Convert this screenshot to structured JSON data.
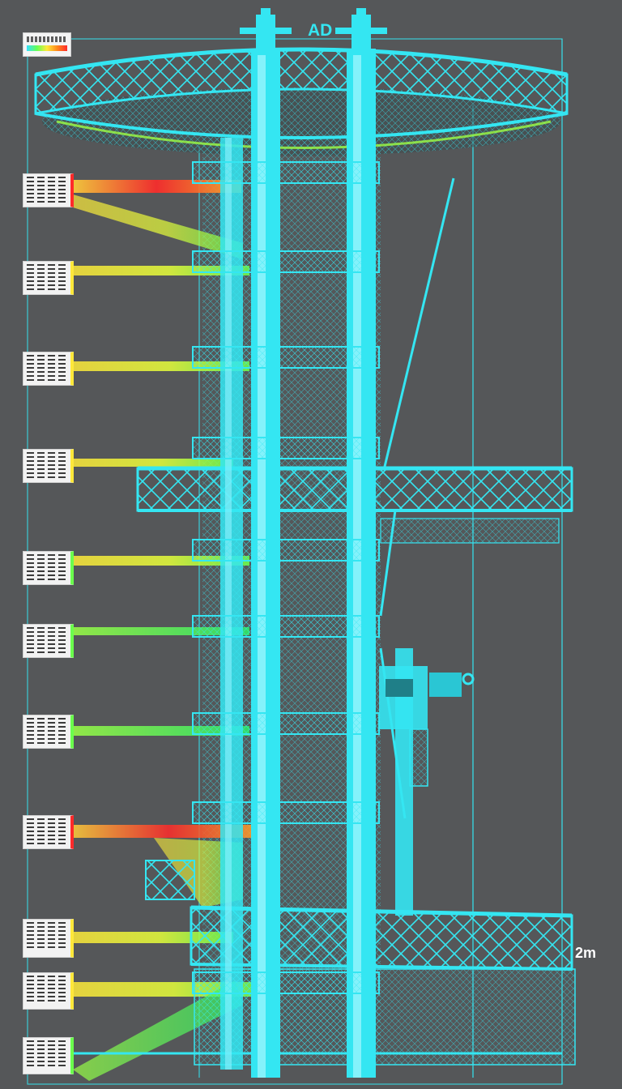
{
  "header": {
    "text": "AD"
  },
  "scale_bar": {
    "label": "2m"
  },
  "colors": {
    "background": "#555759",
    "structure": "#34e6f2",
    "structure_dark": "#1fb9c8",
    "heat_low": "#6bff4d",
    "heat_mid": "#ffe83a",
    "heat_high": "#ff2a2a"
  },
  "annotation_cards": [
    {
      "id": "legend",
      "kind": "legend"
    },
    {
      "id": "tag-1",
      "kind": "tag",
      "heat": "high"
    },
    {
      "id": "tag-2",
      "kind": "tag",
      "heat": "mid"
    },
    {
      "id": "tag-3",
      "kind": "tag",
      "heat": "mid"
    },
    {
      "id": "tag-4",
      "kind": "tag",
      "heat": "mid"
    },
    {
      "id": "tag-5",
      "kind": "tag",
      "heat": "low"
    },
    {
      "id": "tag-6",
      "kind": "tag",
      "heat": "low"
    },
    {
      "id": "tag-7",
      "kind": "tag",
      "heat": "low"
    },
    {
      "id": "tag-8",
      "kind": "tag",
      "heat": "high"
    },
    {
      "id": "tag-9",
      "kind": "tag",
      "heat": "mid"
    },
    {
      "id": "tag-10",
      "kind": "tag",
      "heat": "mid"
    },
    {
      "id": "tag-11",
      "kind": "tag",
      "heat": "low"
    }
  ]
}
